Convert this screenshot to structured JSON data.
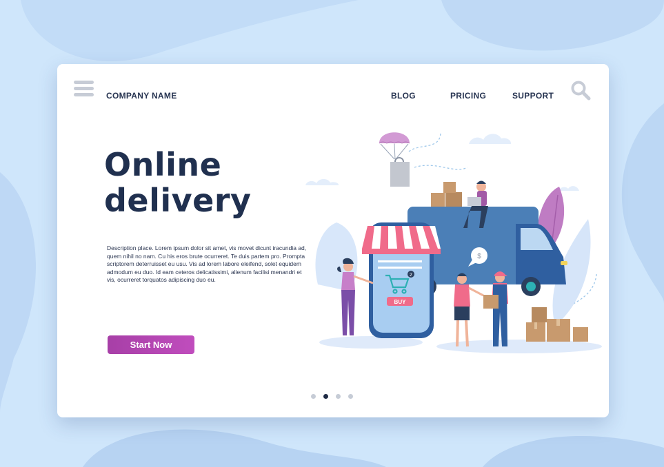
{
  "header": {
    "company_name": "COMPANY NAME",
    "nav": [
      "BLOG",
      "PRICING",
      "SUPPORT"
    ],
    "menu_icon": "hamburger-menu-icon",
    "search_icon": "search-icon"
  },
  "hero": {
    "title_line1": "Online",
    "title_line2": "delivery",
    "description": "Description place.  Lorem ipsum dolor sit amet, vis movet dicunt iracundia ad, quem nihil no nam. Cu his eros brute ocurreret. Te duis partem pro. Prompta scriptorem deterruisset eu usu. Vis ad lorem labore eleifend, solet equidem admodum eu duo. Id eam ceteros delicatissimi, alienum facilisi menandri et vis, ocurreret torquatos adipiscing duo eu.",
    "cta_label": "Start Now"
  },
  "illustration": {
    "buy_label": "BUY",
    "cart_count": "2",
    "dollar_symbol": "$"
  },
  "pagination": {
    "count": 4,
    "active_index": 1
  },
  "colors": {
    "background": "#cfe6fb",
    "text_dark": "#20304f",
    "accent": "#b548b2",
    "truck": "#4b7fb7"
  }
}
